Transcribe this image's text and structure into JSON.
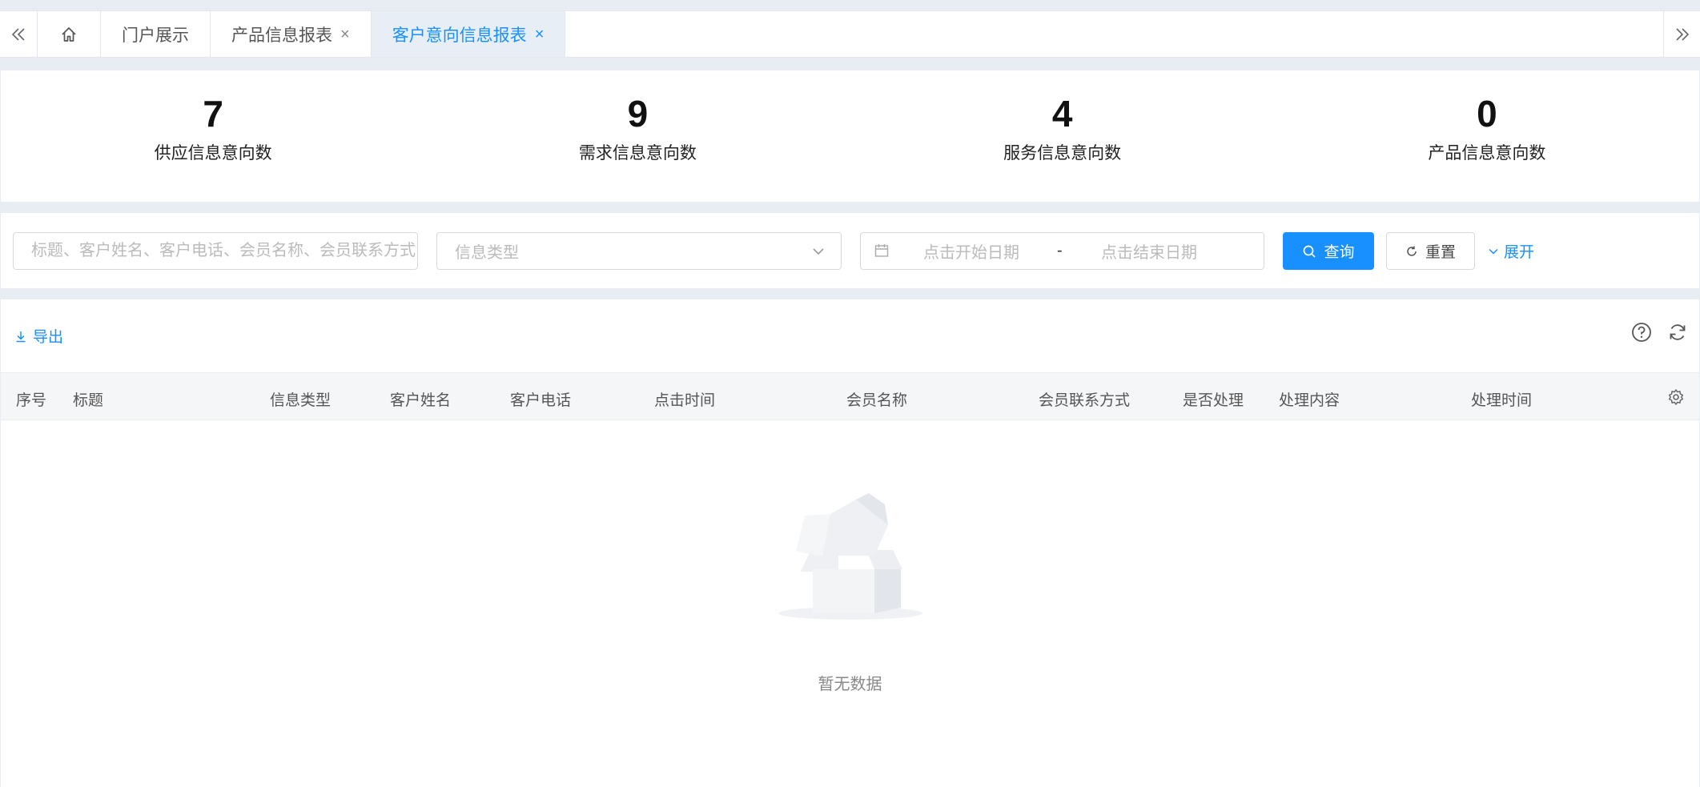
{
  "tabs": {
    "items": [
      {
        "label": "门户展示"
      },
      {
        "label": "产品信息报表",
        "close": "×"
      },
      {
        "label": "客户意向信息报表",
        "close": "×"
      }
    ]
  },
  "stats": [
    {
      "value": "7",
      "label": "供应信息意向数"
    },
    {
      "value": "9",
      "label": "需求信息意向数"
    },
    {
      "value": "4",
      "label": "服务信息意向数"
    },
    {
      "value": "0",
      "label": "产品信息意向数"
    }
  ],
  "filters": {
    "search_placeholder": "标题、客户姓名、客户电话、会员名称、会员联系方式",
    "type_placeholder": "信息类型",
    "date_start_placeholder": "点击开始日期",
    "date_separator": "-",
    "date_end_placeholder": "点击结束日期",
    "query_label": "查询",
    "reset_label": "重置",
    "expand_label": "展开"
  },
  "table": {
    "export_label": "导出",
    "columns": [
      "序号",
      "标题",
      "信息类型",
      "客户姓名",
      "客户电话",
      "点击时间",
      "会员名称",
      "会员联系方式",
      "是否处理",
      "处理内容",
      "处理时间"
    ],
    "empty_text": "暂无数据"
  },
  "colors": {
    "accent": "#1890ff",
    "background": "#e8edf3",
    "header_bg": "#f5f6f8"
  }
}
